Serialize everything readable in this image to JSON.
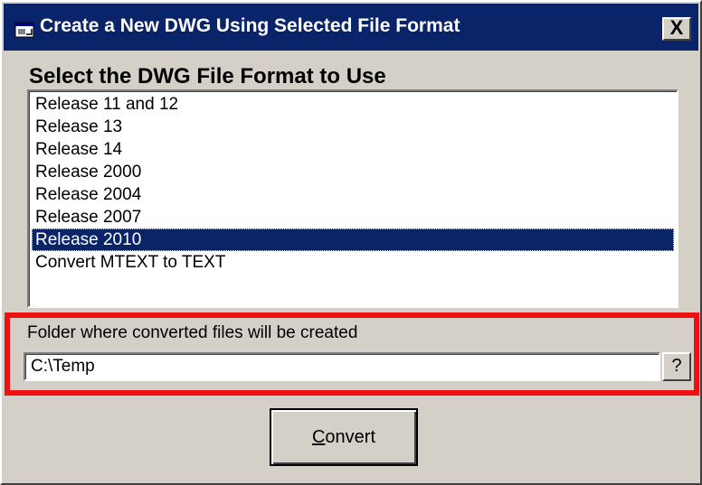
{
  "window": {
    "title": "Create a New DWG Using Selected File Format",
    "close_label": "X"
  },
  "format_section": {
    "heading": "Select the DWG File Format to Use",
    "items": [
      {
        "label": "Release 11 and 12",
        "selected": false
      },
      {
        "label": "Release 13",
        "selected": false
      },
      {
        "label": "Release 14",
        "selected": false
      },
      {
        "label": "Release 2000",
        "selected": false
      },
      {
        "label": "Release 2004",
        "selected": false
      },
      {
        "label": "Release 2007",
        "selected": false
      },
      {
        "label": "Release 2010",
        "selected": true
      },
      {
        "label": "Convert MTEXT to TEXT",
        "selected": false
      }
    ]
  },
  "folder_section": {
    "label": "Folder where converted files will be created",
    "value": "C:\\Temp",
    "browse_label": "?"
  },
  "convert_button": {
    "mnemonic": "C",
    "rest": "onvert"
  },
  "colors": {
    "titlebar": "#0a246a",
    "selection": "#0a246a",
    "highlight_outline": "#ee1111",
    "face": "#d4d0c8"
  }
}
